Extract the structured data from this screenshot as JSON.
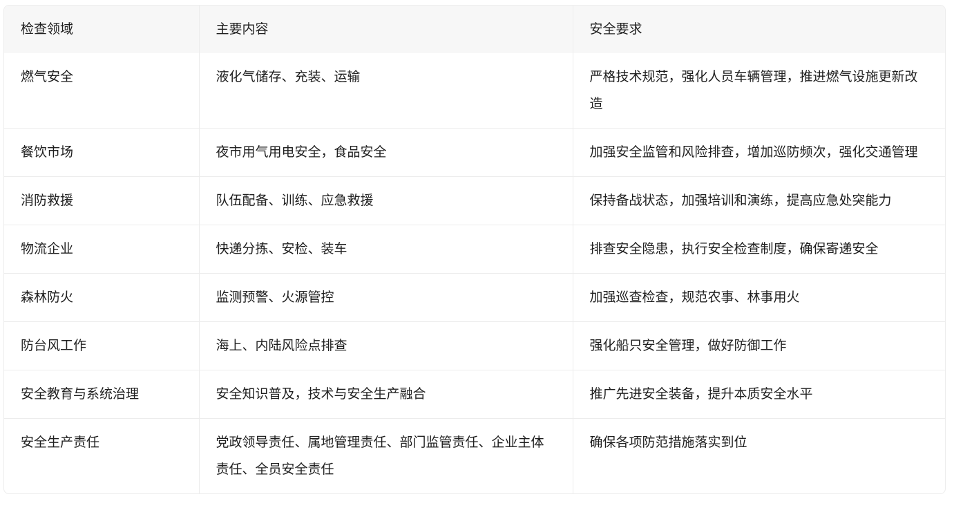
{
  "table": {
    "headers": [
      "检查领域",
      "主要内容",
      "安全要求"
    ],
    "rows": [
      [
        "燃气安全",
        "液化气储存、充装、运输",
        "严格技术规范，强化人员车辆管理，推进燃气设施更新改造"
      ],
      [
        "餐饮市场",
        "夜市用气用电安全，食品安全",
        "加强安全监管和风险排查，增加巡防频次，强化交通管理"
      ],
      [
        "消防救援",
        "队伍配备、训练、应急救援",
        "保持备战状态，加强培训和演练，提高应急处突能力"
      ],
      [
        "物流企业",
        "快递分拣、安检、装车",
        "排查安全隐患，执行安全检查制度，确保寄递安全"
      ],
      [
        "森林防火",
        "监测预警、火源管控",
        "加强巡查检查，规范农事、林事用火"
      ],
      [
        "防台风工作",
        "海上、内陆风险点排查",
        "强化船只安全管理，做好防御工作"
      ],
      [
        "安全教育与系统治理",
        "安全知识普及，技术与安全生产融合",
        "推广先进安全装备，提升本质安全水平"
      ],
      [
        "安全生产责任",
        "党政领导责任、属地管理责任、部门监管责任、企业主体责任、全员安全责任",
        "确保各项防范措施落实到位"
      ]
    ]
  }
}
